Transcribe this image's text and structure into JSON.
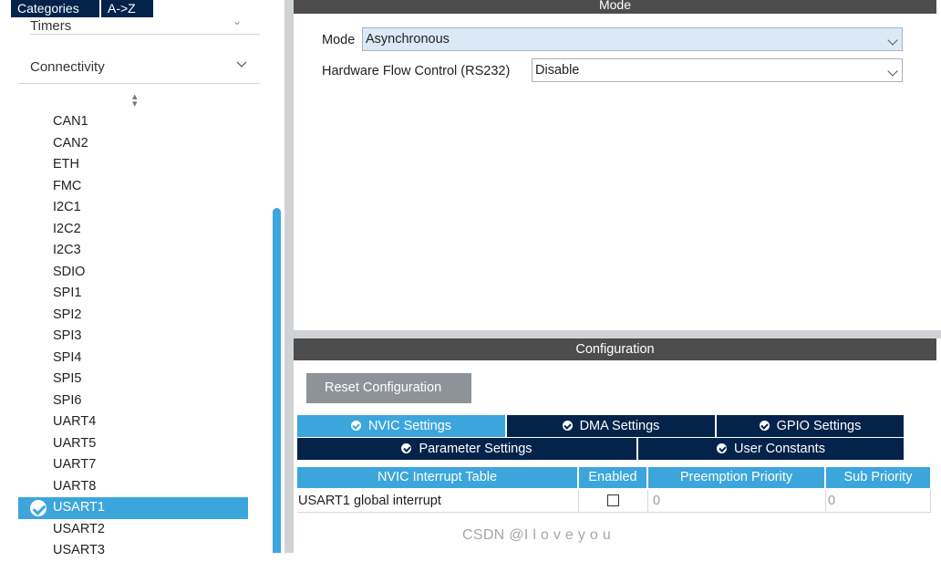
{
  "category_tabs": {
    "categories": "Categories",
    "az": "A->Z"
  },
  "sidebar": {
    "timers_label": "Timers",
    "connectivity_label": "Connectivity",
    "peripherals": [
      "CAN1",
      "CAN2",
      "ETH",
      "FMC",
      "I2C1",
      "I2C2",
      "I2C3",
      "SDIO",
      "SPI1",
      "SPI2",
      "SPI3",
      "SPI4",
      "SPI5",
      "SPI6",
      "UART4",
      "UART5",
      "UART7",
      "UART8",
      "USART1",
      "USART2",
      "USART3"
    ],
    "selected": "USART1"
  },
  "mode_panel": {
    "title": "Mode",
    "mode_label": "Mode",
    "mode_value": "Asynchronous",
    "flow_label": "Hardware Flow Control (RS232)",
    "flow_value": "Disable"
  },
  "config_panel": {
    "title": "Configuration",
    "reset_button": "Reset Configuration",
    "tabs_row1": [
      "NVIC Settings",
      "DMA Settings",
      "GPIO Settings"
    ],
    "tabs_row2": [
      "Parameter Settings",
      "User Constants"
    ],
    "active_tab": "NVIC Settings"
  },
  "nvic_table": {
    "headers": [
      "NVIC Interrupt Table",
      "Enabled",
      "Preemption Priority",
      "Sub Priority"
    ],
    "rows": [
      {
        "name": "USART1 global interrupt",
        "enabled": false,
        "preemption": "0",
        "sub": "0"
      }
    ]
  },
  "watermark": "CSDN @I l o v e y o u",
  "colors": {
    "accent": "#3ca6dc",
    "navy": "#03234b",
    "bar": "#4d4d4d"
  }
}
